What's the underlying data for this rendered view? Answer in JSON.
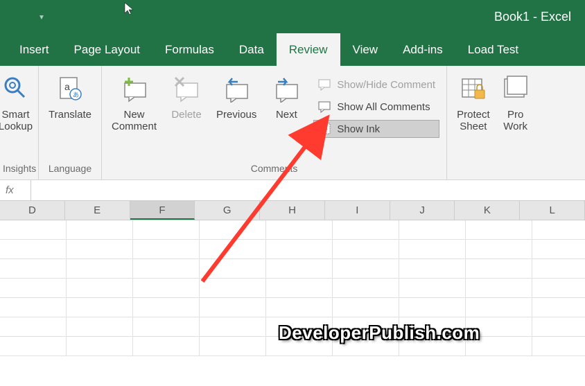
{
  "title": "Book1  -  Excel",
  "tabs": {
    "insert": "Insert",
    "page_layout": "Page Layout",
    "formulas": "Formulas",
    "data": "Data",
    "review": "Review",
    "view": "View",
    "addins": "Add-ins",
    "load_test": "Load Test"
  },
  "active_tab": "Review",
  "ribbon": {
    "insights": {
      "smart_lookup": "Smart Lookup",
      "group": "Insights"
    },
    "language": {
      "translate": "Translate",
      "group": "Language"
    },
    "comments": {
      "new": "New Comment",
      "delete": "Delete",
      "previous": "Previous",
      "next": "Next",
      "show_hide": "Show/Hide Comment",
      "show_all": "Show All Comments",
      "show_ink": "Show Ink",
      "group": "Comments"
    },
    "changes": {
      "protect_sheet": "Protect Sheet",
      "protect_workbook": "Protect Workbook"
    }
  },
  "formula_bar": {
    "fx": "fx",
    "value": ""
  },
  "columns": [
    "D",
    "E",
    "F",
    "G",
    "H",
    "I",
    "J",
    "K",
    "L"
  ],
  "selected_column": "F",
  "watermark": "DeveloperPublish.com"
}
